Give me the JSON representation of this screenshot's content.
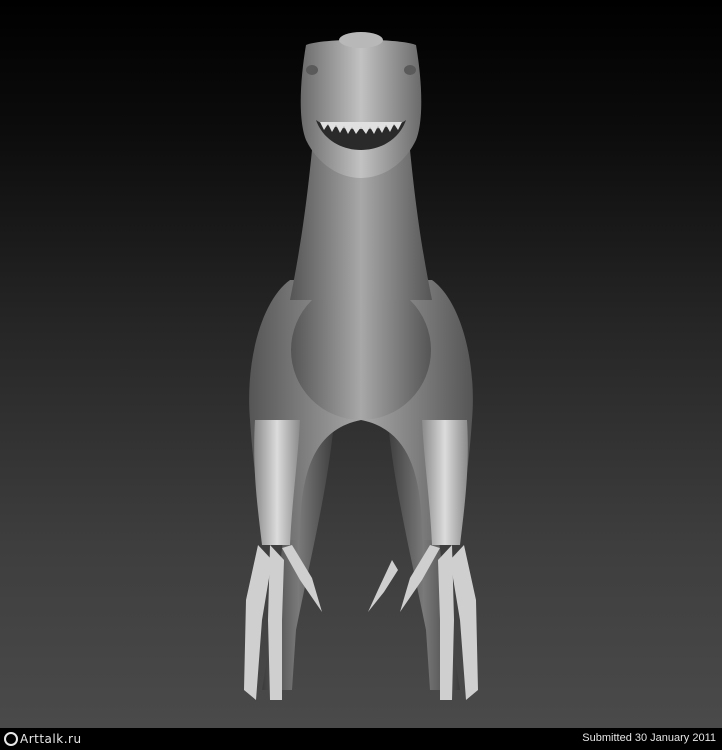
{
  "image": {
    "subject": "dinosaur-sculpt-render",
    "background_top": "#000000",
    "background_bottom": "#4a4a4a",
    "model_color": "#9a9a9a"
  },
  "footer": {
    "logo_text": "Arttalk.ru",
    "submitted_text": "Submitted 30 January 2011"
  }
}
